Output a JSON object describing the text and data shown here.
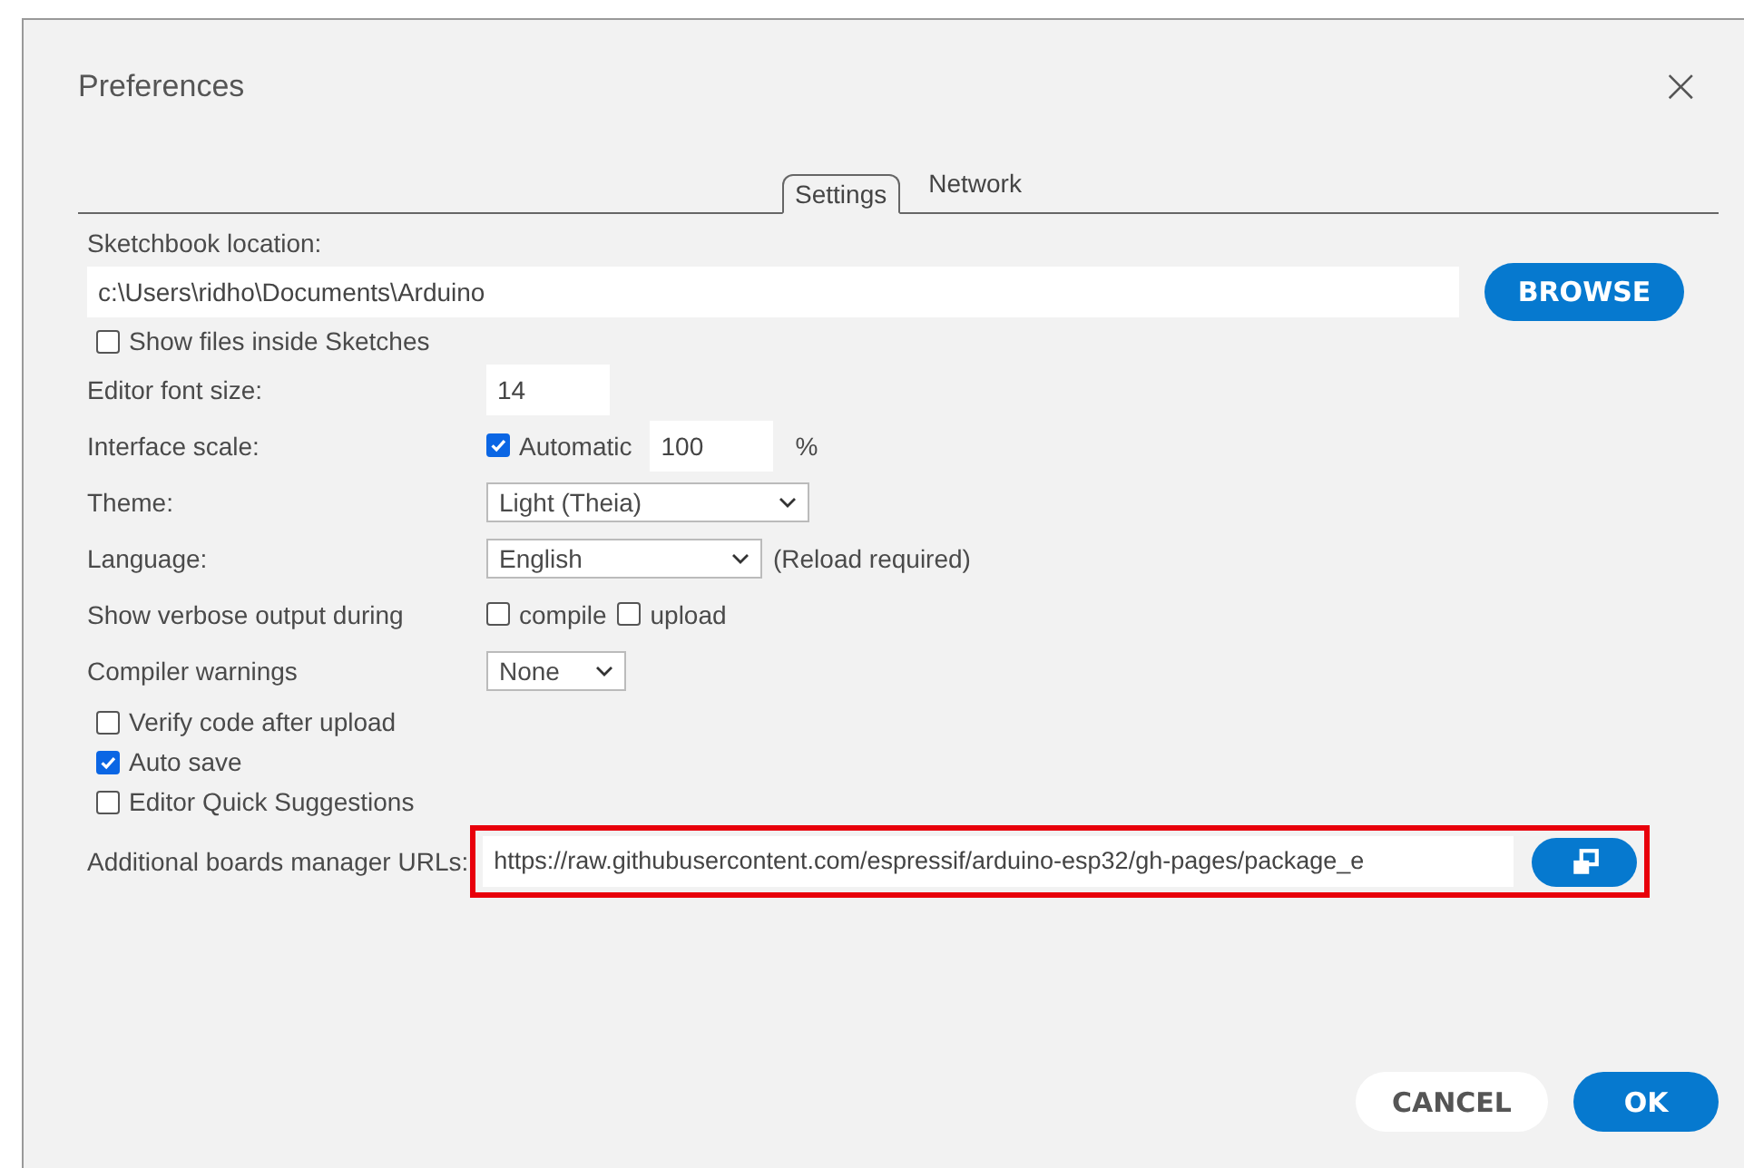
{
  "dialog": {
    "title": "Preferences",
    "close": "×"
  },
  "tabs": [
    {
      "label": "Settings",
      "selected": true
    },
    {
      "label": "Network",
      "selected": false
    }
  ],
  "sketchbook": {
    "label": "Sketchbook location:",
    "value": "c:\\Users\\ridho\\Documents\\Arduino",
    "button": "BROWSE"
  },
  "show_files": {
    "label": "Show files inside Sketches",
    "checked": false
  },
  "font_size": {
    "label": "Editor font size:",
    "value": "14"
  },
  "interface_scale": {
    "label": "Interface scale:",
    "automatic": {
      "label": "Automatic",
      "checked": true
    },
    "value": "100",
    "unit": "%"
  },
  "theme": {
    "label": "Theme:",
    "value": "Light (Theia)"
  },
  "language": {
    "label": "Language:",
    "value": "English",
    "note": "(Reload required)"
  },
  "verbose": {
    "label": "Show verbose output during",
    "options": [
      {
        "label": "compile",
        "checked": false
      },
      {
        "label": "upload",
        "checked": false
      }
    ]
  },
  "compiler_warnings": {
    "label": "Compiler warnings",
    "value": "None"
  },
  "options": [
    {
      "label": "Verify code after upload",
      "checked": false
    },
    {
      "label": "Auto save",
      "checked": true
    },
    {
      "label": "Editor Quick Suggestions",
      "checked": false
    }
  ],
  "boards_urls": {
    "label": "Additional boards manager URLs:",
    "value": "https://raw.githubusercontent.com/espressif/arduino-esp32/gh-pages/package_e",
    "highlighted": true
  },
  "buttons": [
    {
      "label": "CANCEL",
      "kind": "secondary"
    },
    {
      "label": "OK",
      "kind": "primary"
    }
  ]
}
